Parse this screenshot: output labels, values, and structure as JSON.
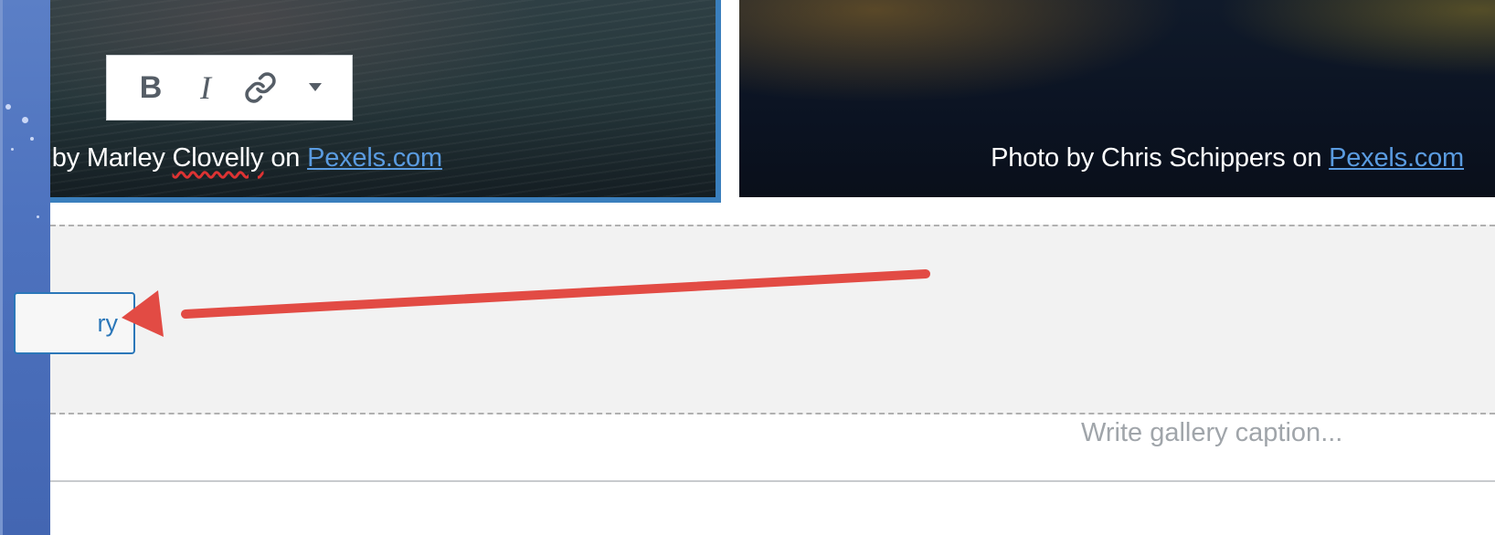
{
  "images": [
    {
      "caption_prefix": "o by Marley ",
      "caption_spell": "Clovelly",
      "caption_mid": " on ",
      "caption_link": "Pexels.com"
    },
    {
      "caption_prefix": "Photo by Chris Schippers on ",
      "caption_link": "Pexels.com"
    }
  ],
  "toolbar": {
    "bold_label": "B",
    "italic_label": "I",
    "link_icon": "link-icon",
    "more_icon": "caret-down-icon"
  },
  "upload": {
    "button_label": "ry"
  },
  "gallery": {
    "caption_placeholder": "Write gallery caption..."
  },
  "colors": {
    "accent": "#3a7fbd",
    "annotation_arrow": "#e24b44",
    "link": "#5a9be0"
  }
}
